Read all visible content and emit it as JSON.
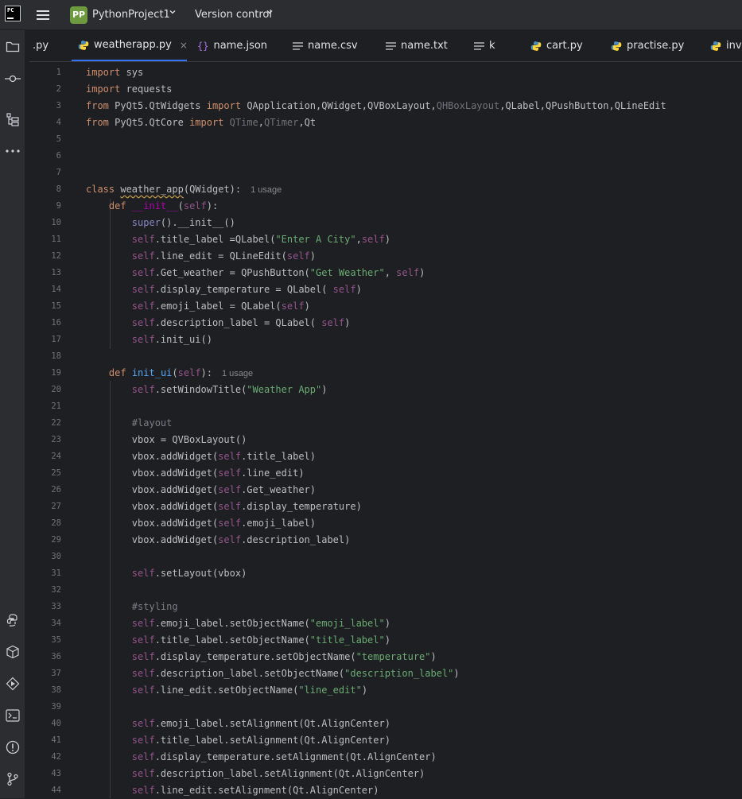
{
  "titlebar": {
    "logo_text": "PC",
    "project_initials": "PP",
    "project_name": "PythonProject1",
    "version_control": "Version control",
    "project_badge_color": "#6e9a3f"
  },
  "left_toolbar": {
    "top_icons": [
      "folder-icon",
      "commit-icon",
      "structure-icon",
      "more-icon"
    ],
    "bottom_icons": [
      "python-console-icon",
      "python-packages-icon",
      "services-icon",
      "terminal-icon",
      "problems-icon",
      "git-icon"
    ]
  },
  "tabs": [
    {
      "label": ".py",
      "icon": "none",
      "active": false
    },
    {
      "label": "weatherapp.py",
      "icon": "python-icon",
      "active": true,
      "close": "×"
    },
    {
      "label": "name.json",
      "icon": "json-icon",
      "active": false
    },
    {
      "label": "name.csv",
      "icon": "text-icon",
      "active": false
    },
    {
      "label": "name.txt",
      "icon": "text-icon",
      "active": false
    },
    {
      "label": "k",
      "icon": "text-icon",
      "active": false
    },
    {
      "label": "cart.py",
      "icon": "python-icon",
      "active": false
    },
    {
      "label": "practise.py",
      "icon": "python-icon",
      "active": false
    },
    {
      "label": "inve",
      "icon": "python-icon",
      "active": false
    }
  ],
  "editor": {
    "accent_color": "#3574f0",
    "line_numbers": [
      "1",
      "2",
      "3",
      "4",
      "5",
      "6",
      "7",
      "8",
      "9",
      "10",
      "11",
      "12",
      "13",
      "14",
      "15",
      "16",
      "17",
      "18",
      "19",
      "20",
      "21",
      "22",
      "23",
      "24",
      "25",
      "26",
      "27",
      "28",
      "29",
      "30",
      "31",
      "32",
      "33",
      "34",
      "35",
      "36",
      "37",
      "38",
      "39",
      "40",
      "41",
      "42",
      "43",
      "44"
    ],
    "usage_hint_class": "1 usage",
    "usage_hint_init_ui": "1 usage",
    "lines": [
      [
        [
          "k",
          "import"
        ],
        [
          "t",
          " sys"
        ]
      ],
      [
        [
          "k",
          "import"
        ],
        [
          "t",
          " requests"
        ]
      ],
      [
        [
          "k",
          "from"
        ],
        [
          "t",
          " PyQt5.QtWidgets "
        ],
        [
          "k",
          "import"
        ],
        [
          "t",
          " QApplication,QWidget,QVBoxLayout,"
        ],
        [
          "dim",
          "QHBoxLayout"
        ],
        [
          "t",
          ",QLabel,QPushButton,QLineEdit"
        ]
      ],
      [
        [
          "k",
          "from"
        ],
        [
          "t",
          " PyQt5.QtCore "
        ],
        [
          "k",
          "import"
        ],
        [
          "t",
          " "
        ],
        [
          "dim",
          "QTime"
        ],
        [
          "t",
          ","
        ],
        [
          "dim",
          "QTimer"
        ],
        [
          "t",
          ",Qt"
        ]
      ],
      [],
      [],
      [],
      [
        [
          "k",
          "class"
        ],
        [
          "t",
          " "
        ],
        [
          "warn",
          "weather_app"
        ],
        [
          "t",
          "(QWidget):"
        ],
        [
          "hint",
          "1 usage"
        ]
      ],
      [
        [
          "t",
          "    "
        ],
        [
          "k",
          "def"
        ],
        [
          "t",
          " "
        ],
        [
          "mg",
          "__init__"
        ],
        [
          "t",
          "("
        ],
        [
          "self",
          "self"
        ],
        [
          "t",
          "):"
        ]
      ],
      [
        [
          "t",
          "        "
        ],
        [
          "bi",
          "super"
        ],
        [
          "t",
          "().__init__()"
        ]
      ],
      [
        [
          "t",
          "        "
        ],
        [
          "self",
          "self"
        ],
        [
          "t",
          ".title_label =QLabel("
        ],
        [
          "s",
          "\"Enter A City\""
        ],
        [
          "t",
          ","
        ],
        [
          "self",
          "self"
        ],
        [
          "t",
          ")"
        ]
      ],
      [
        [
          "t",
          "        "
        ],
        [
          "self",
          "self"
        ],
        [
          "t",
          ".line_edit = QLineEdit("
        ],
        [
          "self",
          "self"
        ],
        [
          "t",
          ")"
        ]
      ],
      [
        [
          "t",
          "        "
        ],
        [
          "self",
          "self"
        ],
        [
          "t",
          ".Get_weather = QPushButton("
        ],
        [
          "s",
          "\"Get Weather\""
        ],
        [
          "t",
          ", "
        ],
        [
          "self",
          "self"
        ],
        [
          "t",
          ")"
        ]
      ],
      [
        [
          "t",
          "        "
        ],
        [
          "self",
          "self"
        ],
        [
          "t",
          ".display_temperature = QLabel( "
        ],
        [
          "self",
          "self"
        ],
        [
          "t",
          ")"
        ]
      ],
      [
        [
          "t",
          "        "
        ],
        [
          "self",
          "self"
        ],
        [
          "t",
          ".emoji_label = QLabel("
        ],
        [
          "self",
          "self"
        ],
        [
          "t",
          ")"
        ]
      ],
      [
        [
          "t",
          "        "
        ],
        [
          "self",
          "self"
        ],
        [
          "t",
          ".description_label = QLabel( "
        ],
        [
          "self",
          "self"
        ],
        [
          "t",
          ")"
        ]
      ],
      [
        [
          "t",
          "        "
        ],
        [
          "self",
          "self"
        ],
        [
          "t",
          ".init_ui()"
        ]
      ],
      [],
      [
        [
          "t",
          "    "
        ],
        [
          "k",
          "def"
        ],
        [
          "t",
          " "
        ],
        [
          "fn",
          "init_ui"
        ],
        [
          "t",
          "("
        ],
        [
          "self",
          "self"
        ],
        [
          "t",
          "):"
        ],
        [
          "hint",
          "1 usage"
        ]
      ],
      [
        [
          "t",
          "        "
        ],
        [
          "self",
          "self"
        ],
        [
          "t",
          ".setWindowTitle("
        ],
        [
          "s",
          "\"Weather App\""
        ],
        [
          "t",
          ")"
        ]
      ],
      [],
      [
        [
          "t",
          "        "
        ],
        [
          "cm",
          "#layout"
        ]
      ],
      [
        [
          "t",
          "        vbox = QVBoxLayout()"
        ]
      ],
      [
        [
          "t",
          "        vbox.addWidget("
        ],
        [
          "self",
          "self"
        ],
        [
          "t",
          ".title_label)"
        ]
      ],
      [
        [
          "t",
          "        vbox.addWidget("
        ],
        [
          "self",
          "self"
        ],
        [
          "t",
          ".line_edit)"
        ]
      ],
      [
        [
          "t",
          "        vbox.addWidget("
        ],
        [
          "self",
          "self"
        ],
        [
          "t",
          ".Get_weather)"
        ]
      ],
      [
        [
          "t",
          "        vbox.addWidget("
        ],
        [
          "self",
          "self"
        ],
        [
          "t",
          ".display_temperature)"
        ]
      ],
      [
        [
          "t",
          "        vbox.addWidget("
        ],
        [
          "self",
          "self"
        ],
        [
          "t",
          ".emoji_label)"
        ]
      ],
      [
        [
          "t",
          "        vbox.addWidget("
        ],
        [
          "self",
          "self"
        ],
        [
          "t",
          ".description_label)"
        ]
      ],
      [],
      [
        [
          "t",
          "        "
        ],
        [
          "self",
          "self"
        ],
        [
          "t",
          ".setLayout(vbox)"
        ]
      ],
      [],
      [
        [
          "t",
          "        "
        ],
        [
          "cm",
          "#styling"
        ]
      ],
      [
        [
          "t",
          "        "
        ],
        [
          "self",
          "self"
        ],
        [
          "t",
          ".emoji_label.setObjectName("
        ],
        [
          "s",
          "\"emoji_label\""
        ],
        [
          "t",
          ")"
        ]
      ],
      [
        [
          "t",
          "        "
        ],
        [
          "self",
          "self"
        ],
        [
          "t",
          ".title_label.setObjectName("
        ],
        [
          "s",
          "\"title_label\""
        ],
        [
          "t",
          ")"
        ]
      ],
      [
        [
          "t",
          "        "
        ],
        [
          "self",
          "self"
        ],
        [
          "t",
          ".display_temperature.setObjectName("
        ],
        [
          "s",
          "\"temperature\""
        ],
        [
          "t",
          ")"
        ]
      ],
      [
        [
          "t",
          "        "
        ],
        [
          "self",
          "self"
        ],
        [
          "t",
          ".description_label.setObjectName("
        ],
        [
          "s",
          "\"description_label\""
        ],
        [
          "t",
          ")"
        ]
      ],
      [
        [
          "t",
          "        "
        ],
        [
          "self",
          "self"
        ],
        [
          "t",
          ".line_edit.setObjectName("
        ],
        [
          "s",
          "\"line_edit\""
        ],
        [
          "t",
          ")"
        ]
      ],
      [],
      [
        [
          "t",
          "        "
        ],
        [
          "self",
          "self"
        ],
        [
          "t",
          ".emoji_label.setAlignment(Qt.AlignCenter)"
        ]
      ],
      [
        [
          "t",
          "        "
        ],
        [
          "self",
          "self"
        ],
        [
          "t",
          ".title_label.setAlignment(Qt.AlignCenter)"
        ]
      ],
      [
        [
          "t",
          "        "
        ],
        [
          "self",
          "self"
        ],
        [
          "t",
          ".display_temperature.setAlignment(Qt.AlignCenter)"
        ]
      ],
      [
        [
          "t",
          "        "
        ],
        [
          "self",
          "self"
        ],
        [
          "t",
          ".description_label.setAlignment(Qt.AlignCenter)"
        ]
      ],
      [
        [
          "t",
          "        "
        ],
        [
          "self",
          "self"
        ],
        [
          "t",
          ".line_edit.setAlignment(Qt.AlignCenter)"
        ]
      ]
    ]
  }
}
